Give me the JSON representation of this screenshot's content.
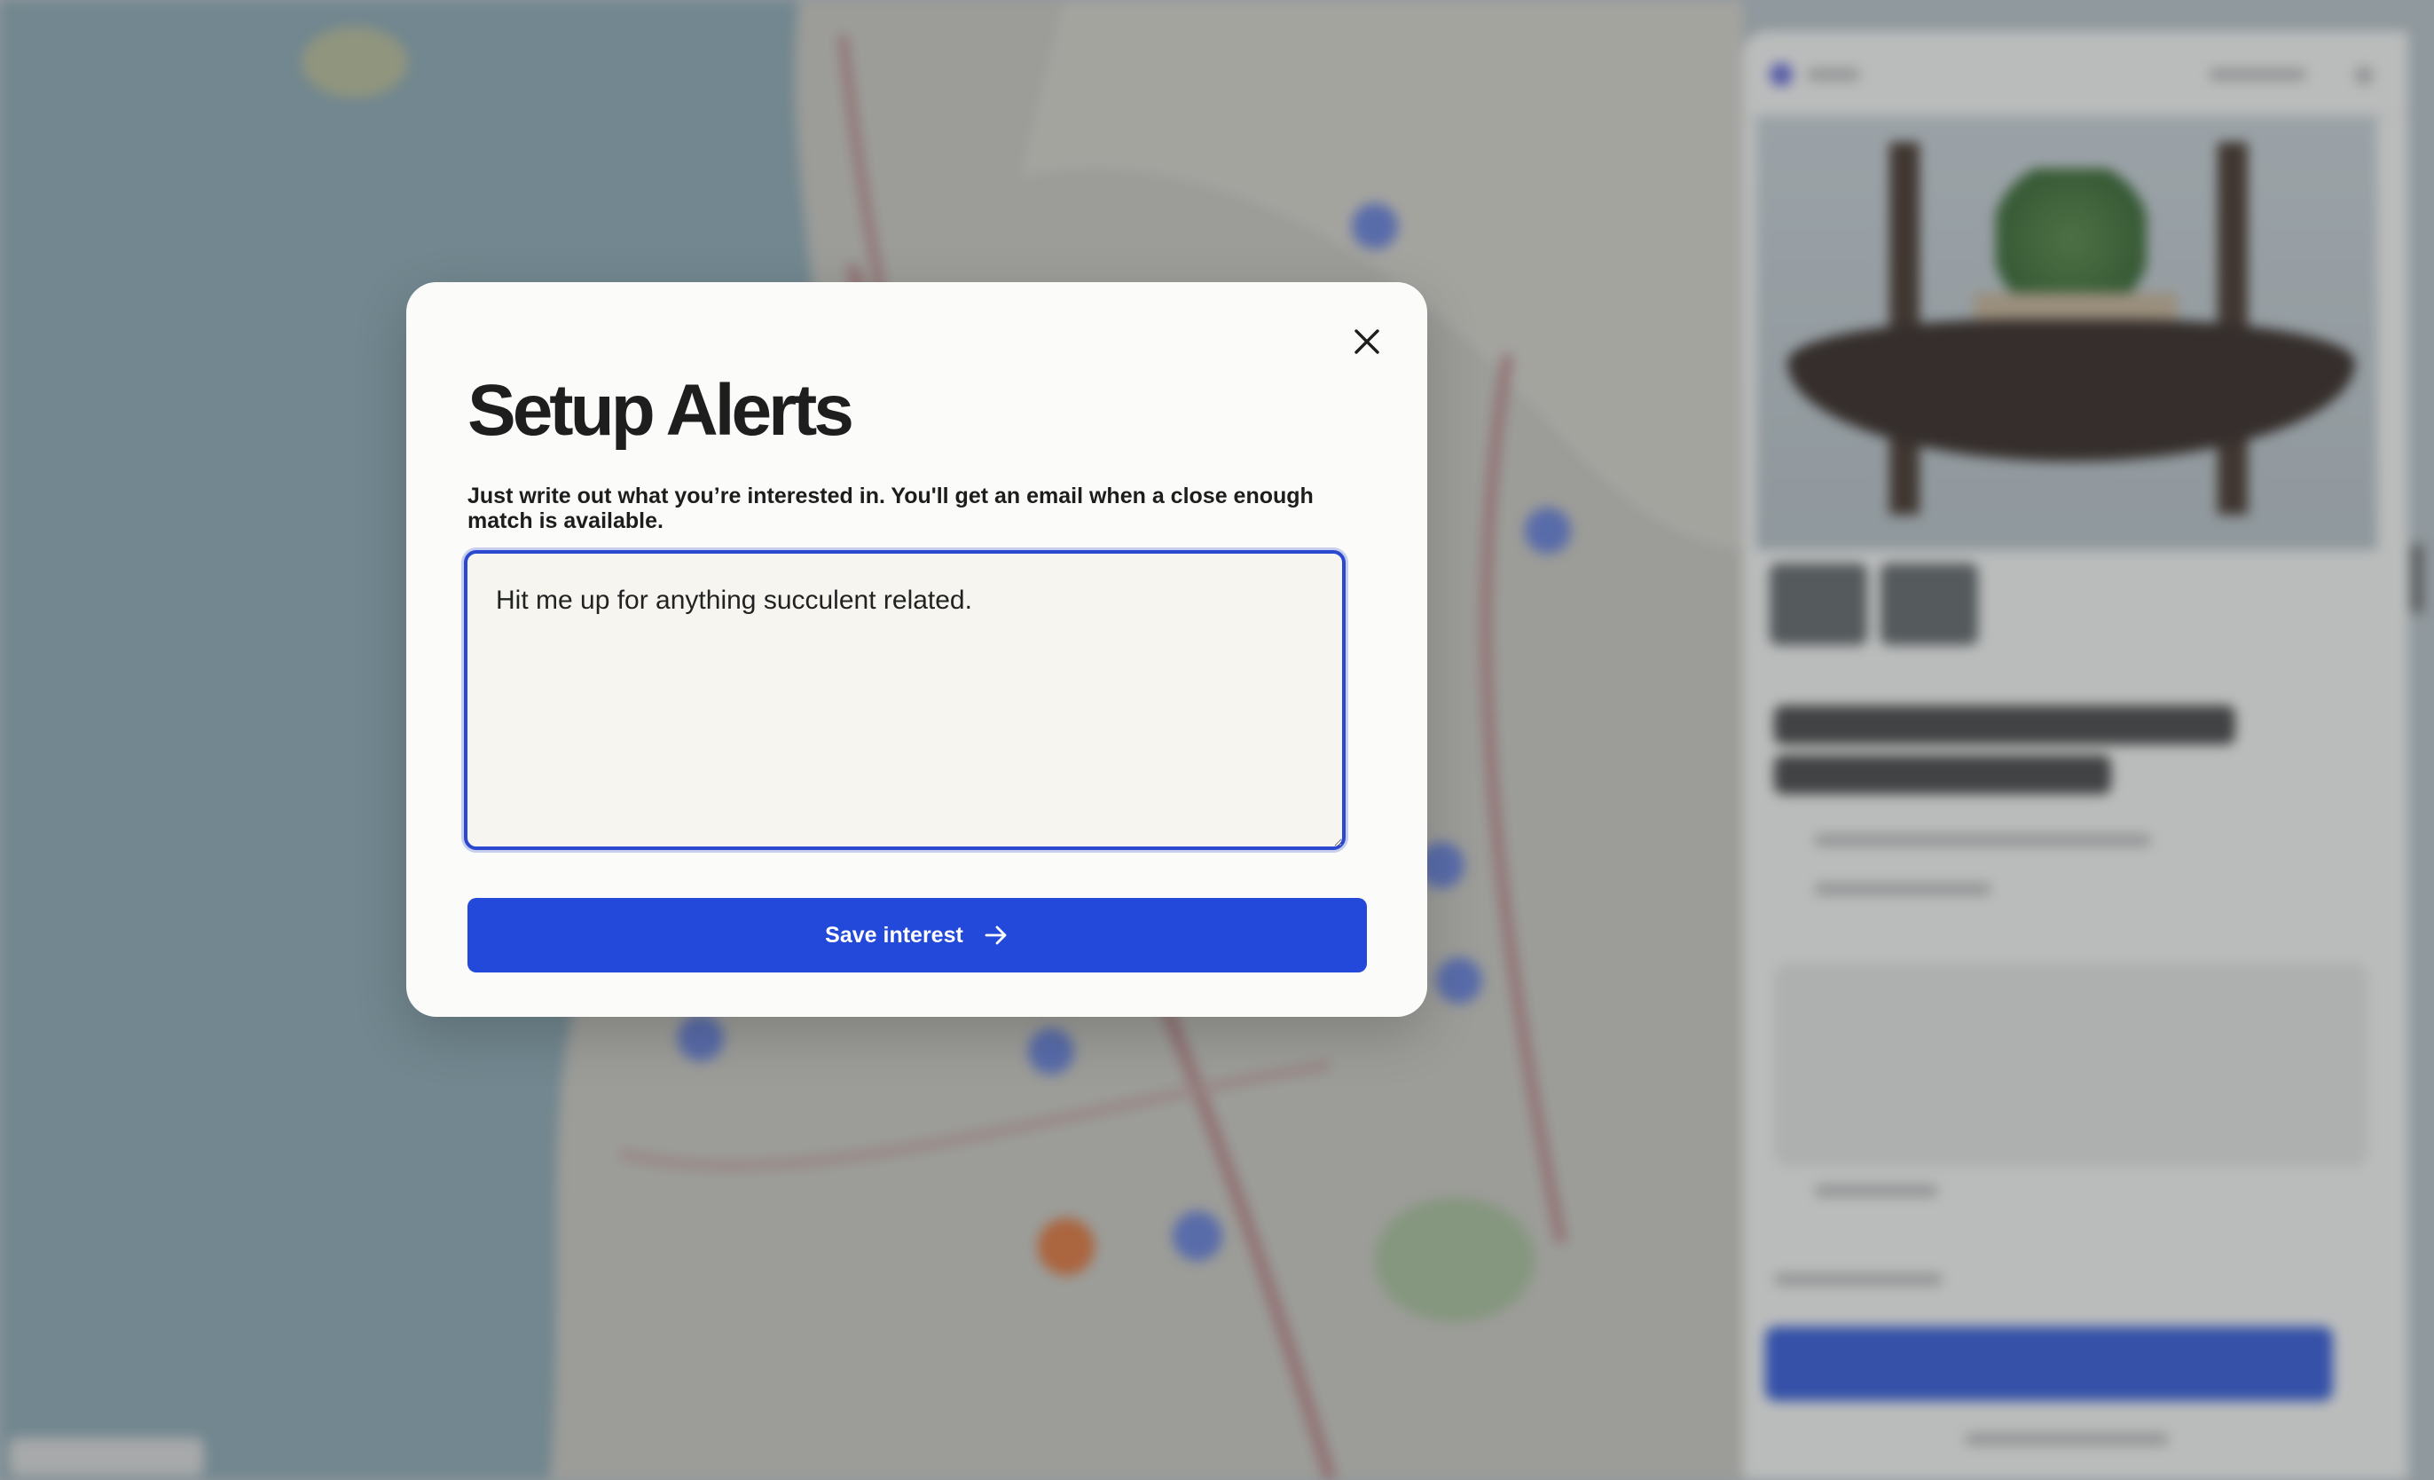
{
  "modal": {
    "title": "Setup Alerts",
    "description": "Just write out what you’re interested in. You'll get an email when a close enough match is available.",
    "input_value": "Hit me up for anything succulent related.",
    "save_label": "Save interest",
    "close_icon": "close-icon",
    "arrow_icon": "arrow-right-icon"
  },
  "colors": {
    "accent": "#2249d9",
    "focus_border": "#2a49d0",
    "modal_bg": "#fbfbf9",
    "input_bg": "#f6f5f0"
  }
}
